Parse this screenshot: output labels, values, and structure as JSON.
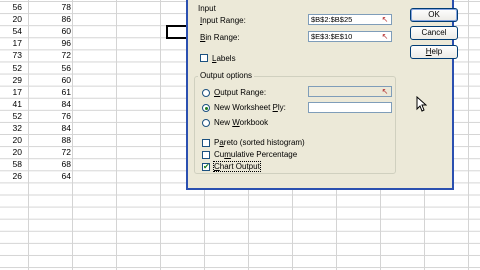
{
  "sheet": {
    "rows": [
      {
        "a": "56",
        "b": "78"
      },
      {
        "a": "20",
        "b": "86"
      },
      {
        "a": "54",
        "b": "60"
      },
      {
        "a": "17",
        "b": "96"
      },
      {
        "a": "73",
        "b": "72"
      },
      {
        "a": "52",
        "b": "56"
      },
      {
        "a": "29",
        "b": "60"
      },
      {
        "a": "17",
        "b": "61"
      },
      {
        "a": "41",
        "b": "84"
      },
      {
        "a": "52",
        "b": "76"
      },
      {
        "a": "32",
        "b": "84"
      },
      {
        "a": "20",
        "b": "88"
      },
      {
        "a": "20",
        "b": "72"
      },
      {
        "a": "58",
        "b": "68"
      },
      {
        "a": "26",
        "b": "64"
      }
    ]
  },
  "dialog": {
    "input_group_label": "Input",
    "input_range": {
      "label_u": "I",
      "label_rest": "nput Range:",
      "value": "$B$2:$B$25"
    },
    "bin_range": {
      "label_u": "B",
      "label_rest": "in Range:",
      "value": "$E$3:$E$10"
    },
    "labels": {
      "label_u": "L",
      "label_rest": "abels",
      "checked": false
    },
    "output_group_label": "Output options",
    "output_range": {
      "label_u": "O",
      "label_rest": "utput Range:",
      "value": "",
      "selected": false
    },
    "new_worksheet": {
      "label_pre": "New Worksheet ",
      "label_u": "P",
      "label_rest": "ly:",
      "value": "",
      "selected": true
    },
    "new_workbook": {
      "label_pre": "New ",
      "label_u": "W",
      "label_rest": "orkbook",
      "selected": false
    },
    "pareto": {
      "label_pre": "P",
      "label_u": "a",
      "label_rest": "reto (sorted histogram)",
      "checked": false
    },
    "cumulative": {
      "label_pre": "Cu",
      "label_u": "m",
      "label_rest": "ulative Percentage",
      "checked": false
    },
    "chart_output": {
      "label_pre": "",
      "label_u": "C",
      "label_rest": "hart Output",
      "checked": true,
      "check_glyph": "✔"
    },
    "ref_glyph": "↖",
    "buttons": {
      "ok": "OK",
      "cancel": "Cancel",
      "help_u": "H",
      "help_rest": "elp"
    }
  },
  "colors": {
    "dialog_bg": "#ece9d8",
    "title_blue": "#2b50b0",
    "check_green": "#1e7b1e"
  }
}
